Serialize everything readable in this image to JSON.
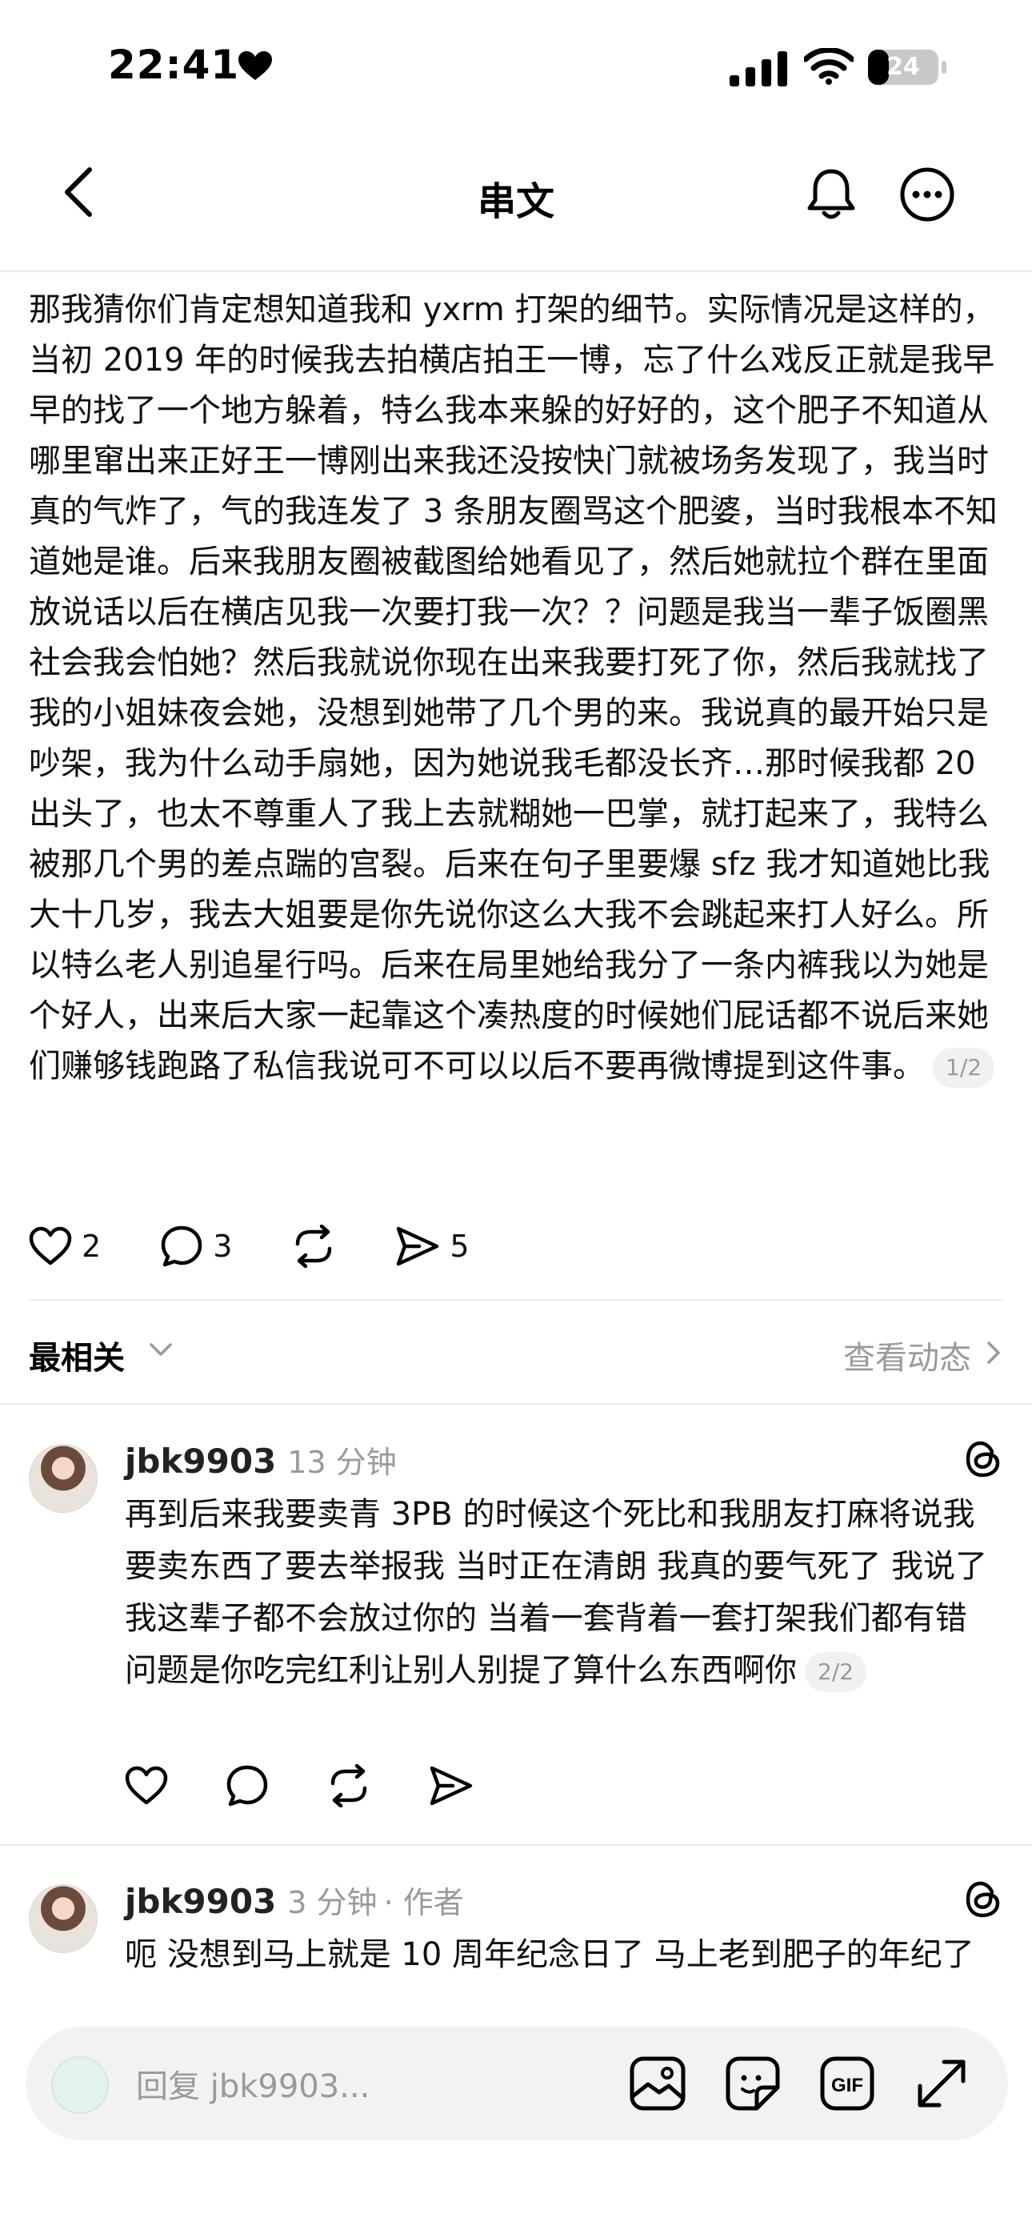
{
  "status_bar": {
    "time": "22:41",
    "battery": "24"
  },
  "header": {
    "title": "串文"
  },
  "post": {
    "text": "那我猜你们肯定想知道我和 yxrm 打架的细节。实际情况是这样的，当初 2019 年的时候我去拍横店拍王一博，忘了什么戏反正就是我早早的找了一个地方躲着，特么我本来躲的好好的，这个肥子不知道从哪里窜出来正好王一博刚出来我还没按快门就被场务发现了，我当时真的气炸了，气的我连发了 3 条朋友圈骂这个肥婆，当时我根本不知道她是谁。后来我朋友圈被截图给她看见了，然后她就拉个群在里面放说话以后在横店见我一次要打我一次？？问题是我当一辈子饭圈黑社会我会怕她？然后我就说你现在出来我要打死了你，然后我就找了我的小姐妹夜会她，没想到她带了几个男的来。我说真的最开始只是吵架，我为什么动手扇她，因为她说我毛都没长齐…那时候我都 20 出头了，也太不尊重人了我上去就糊她一巴掌，就打起来了，我特么被那几个男的差点踹的宫裂。后来在句子里要爆 sfz 我才知道她比我大十几岁，我去大姐要是你先说你这么大我不会跳起来打人好么。所以特么老人别追星行吗。后来在局里她给我分了一条内裤我以为她是个好人，出来后大家一起靠这个凑热度的时候她们屁话都不说后来她们赚够钱跑路了私信我说可不可以以后不要再微博提到这件事。",
    "page_indicator": "1/2",
    "likes": "2",
    "comments": "3",
    "shares": "5"
  },
  "sort": {
    "label": "最相关",
    "view_activity": "查看动态"
  },
  "replies": [
    {
      "username": "jbk9903",
      "time": "13 分钟",
      "author_tag": "",
      "text": "再到后来我要卖青 3PB 的时候这个死比和我朋友打麻将说我要卖东西了要去举报我 当时正在清朗 我真的要气死了 我说了我这辈子都不会放过你的 当着一套背着一套打架我们都有错 问题是你吃完红利让别人别提了算什么东西啊你",
      "page_indicator": "2/2"
    },
    {
      "username": "jbk9903",
      "time": "3 分钟",
      "author_tag": "· 作者",
      "text": "呃 没想到马上就是 10 周年纪念日了 马上老到肥子的年纪了"
    }
  ],
  "composer": {
    "placeholder": "回复 jbk9903..."
  },
  "icons": [
    "back-icon",
    "bell-icon",
    "more-icon",
    "heart-icon",
    "comment-icon",
    "repost-icon",
    "share-icon",
    "chevron-down-icon",
    "chevron-right-icon",
    "threads-icon",
    "gallery-icon",
    "sticker-icon",
    "gif-icon",
    "expand-icon"
  ]
}
